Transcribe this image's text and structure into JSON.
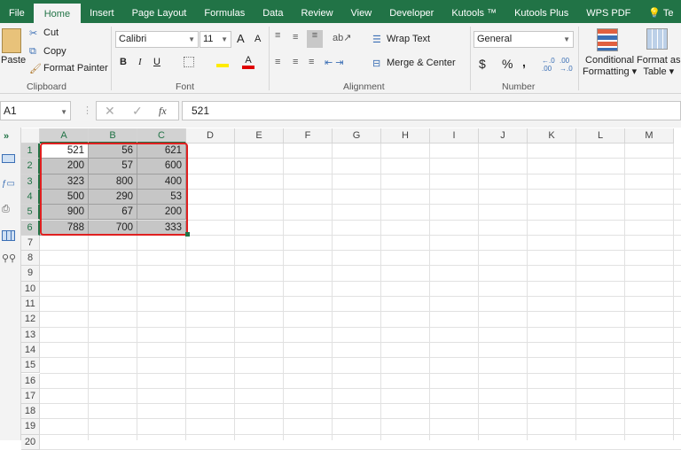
{
  "tabs": [
    "File",
    "Home",
    "Insert",
    "Page Layout",
    "Formulas",
    "Data",
    "Review",
    "View",
    "Developer",
    "Kutools ™",
    "Kutools Plus",
    "WPS PDF",
    "Te"
  ],
  "clipboard": {
    "paste": "Paste",
    "cut": "Cut",
    "copy": "Copy",
    "format_painter": "Format Painter",
    "group": "Clipboard"
  },
  "font": {
    "name": "Calibri",
    "size": "11",
    "bold": "B",
    "italic": "I",
    "underline": "U",
    "font_color": "A",
    "grow": "A",
    "shrink": "A",
    "group": "Font"
  },
  "alignment": {
    "wrap": "Wrap Text",
    "merge": "Merge & Center",
    "group": "Alignment"
  },
  "number": {
    "format": "General",
    "currency": "$",
    "percent": "%",
    "comma": ",",
    "group": "Number"
  },
  "styles": {
    "conditional1": "Conditional",
    "conditional2": "Formatting",
    "table1": "Format as",
    "table2": "Table"
  },
  "formula_bar": {
    "name_box": "A1",
    "fx": "fx",
    "value": "521"
  },
  "columns": [
    "A",
    "B",
    "C",
    "D",
    "E",
    "F",
    "G",
    "H",
    "I",
    "J",
    "K",
    "L",
    "M"
  ],
  "rows": [
    "1",
    "2",
    "3",
    "4",
    "5",
    "6",
    "7",
    "8",
    "9",
    "10",
    "11",
    "12",
    "13",
    "14",
    "15",
    "16",
    "17",
    "18",
    "19",
    "20"
  ],
  "cells": [
    [
      "521",
      "56",
      "621"
    ],
    [
      "200",
      "57",
      "600"
    ],
    [
      "323",
      "800",
      "400"
    ],
    [
      "500",
      "290",
      "53"
    ],
    [
      "900",
      "67",
      "200"
    ],
    [
      "788",
      "700",
      "333"
    ]
  ],
  "colors": {
    "brand": "#217346",
    "selection": "#c6c6c6",
    "highlight": "#e02020"
  }
}
